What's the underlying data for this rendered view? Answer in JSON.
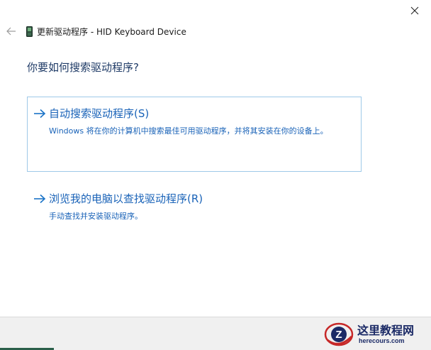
{
  "window": {
    "title": "更新驱动程序 - HID Keyboard Device"
  },
  "icons": {
    "close": "close-icon",
    "back": "back-arrow-icon",
    "device": "keyboard-device-icon",
    "option_arrow": "right-arrow-icon"
  },
  "main": {
    "heading": "你要如何搜索驱动程序?",
    "options": [
      {
        "title": "自动搜索驱动程序(S)",
        "description": "Windows 将在你的计算机中搜索最佳可用驱动程序，并将其安装在你的设备上。"
      },
      {
        "title": "浏览我的电脑以查找驱动程序(R)",
        "description": "手动查找并安装驱动程序。"
      }
    ]
  },
  "watermark": {
    "name": "这里教程网",
    "url": "herecours.com",
    "logo_letter": "Z"
  },
  "colors": {
    "link_blue": "#1a63b8",
    "heading_navy": "#1e3a66",
    "selected_border": "#9ec9e8",
    "footer_bg": "#f0f0f0",
    "progress_green": "#2a5f4a"
  }
}
